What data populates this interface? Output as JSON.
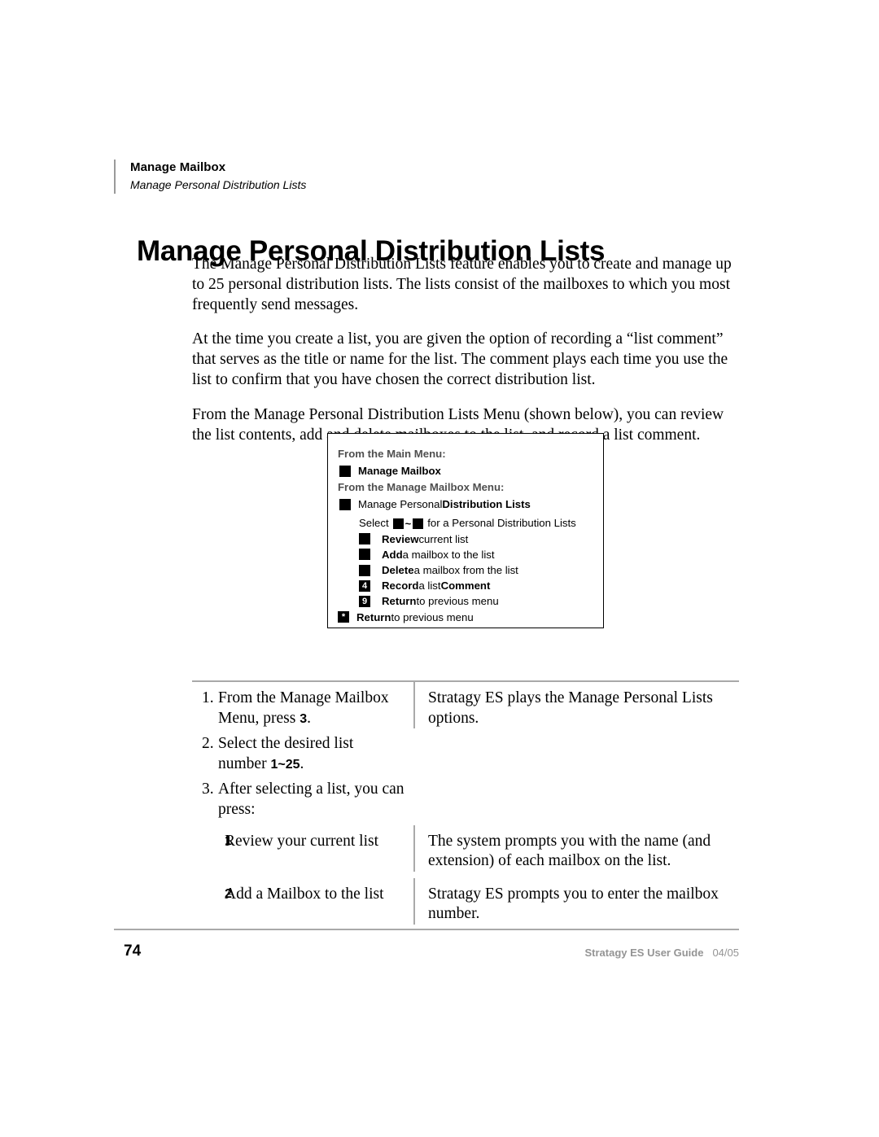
{
  "running_header": {
    "title": "Manage Mailbox",
    "subtitle": "Manage Personal Distribution Lists"
  },
  "page_title": "Manage Personal Distribution Lists",
  "paragraphs": [
    "The Manage Personal Distribution Lists feature enables you to create and manage up to 25 personal distribution lists. The lists consist of the mailboxes to which you most frequently send messages.",
    "At the time you create a list, you are given the option of recording a “list comment” that serves as the title or name for the list. The comment plays each time you use the list to confirm that you have chosen the correct distribution list.",
    "From the Manage Personal Distribution Lists Menu (shown below), you can review the list contents, add and delete mailboxes to the list, and record a list comment."
  ],
  "menu_box": {
    "heading_1": "From the Main Menu:",
    "item_1_key": "",
    "item_1_label": "Manage Mailbox",
    "heading_2": "From the Manage Mailbox Menu:",
    "item_2_key": "",
    "item_2_label_normal": "Manage Personal ",
    "item_2_label_bold": "Distribution Lists",
    "select_prefix": "Select",
    "select_key_from": "",
    "select_tilde": "~",
    "select_key_to": "",
    "select_suffix": "for a Personal Distribution Lists",
    "options": [
      {
        "key": "",
        "bold": "Review",
        "rest": " current list"
      },
      {
        "key": "",
        "bold": "Add",
        "rest": " a mailbox to the list"
      },
      {
        "key": "",
        "bold": "Delete",
        "rest": " a mailbox from the list"
      },
      {
        "key": "4",
        "bold": "Record",
        "rest": " a list ",
        "bold2": "Comment"
      },
      {
        "key": "9",
        "bold": "Return",
        "rest": " to previous menu"
      }
    ],
    "return_key": "*",
    "return_bold": "Return",
    "return_rest": " to previous menu"
  },
  "procedure": {
    "rows": [
      {
        "num": "1.",
        "left_text": "From the Manage Mailbox Menu, press ",
        "left_key": "3",
        "left_tail": ".",
        "right_text": "Stratagy ES plays the Manage Personal Lists options."
      },
      {
        "num": "2.",
        "left_text": "Select the desired list number ",
        "left_key": "1~25",
        "left_tail": ".",
        "right_text": ""
      },
      {
        "num": "3.",
        "left_text": "After selecting a list, you can press:",
        "left_key": "",
        "left_tail": "",
        "right_text": ""
      }
    ],
    "sub_rows": [
      {
        "key": "1",
        "left_text": "Review your current list",
        "right_text": "The system prompts you with the name (and extension) of each mailbox on the list."
      },
      {
        "key": "2",
        "left_text": "Add a Mailbox to the list",
        "right_text": "Stratagy ES prompts you to enter the mailbox number."
      }
    ]
  },
  "footer": {
    "page_number": "74",
    "guide": "Stratagy ES User Guide",
    "date": "04/05"
  }
}
